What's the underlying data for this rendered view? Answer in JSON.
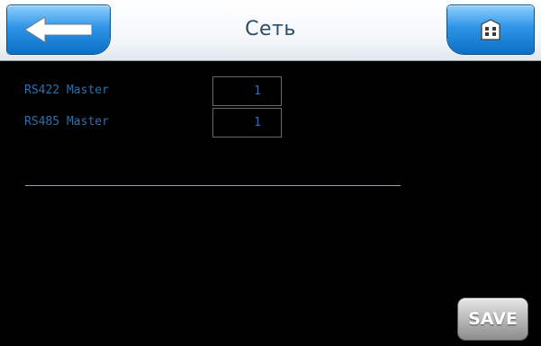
{
  "header": {
    "title": "Сеть",
    "back_icon": "arrow-left-icon",
    "home_icon": "building-icon"
  },
  "rows": [
    {
      "label": "RS422 Master",
      "value": "1"
    },
    {
      "label": "RS485 Master",
      "value": "1"
    }
  ],
  "actions": {
    "save_label": "SAVE"
  },
  "colors": {
    "background": "#000000",
    "label": "#2f6fae",
    "header_bg": "#f3f6f9",
    "button_blue": "#2f95e6",
    "save_gray": "#bdbdbd"
  }
}
